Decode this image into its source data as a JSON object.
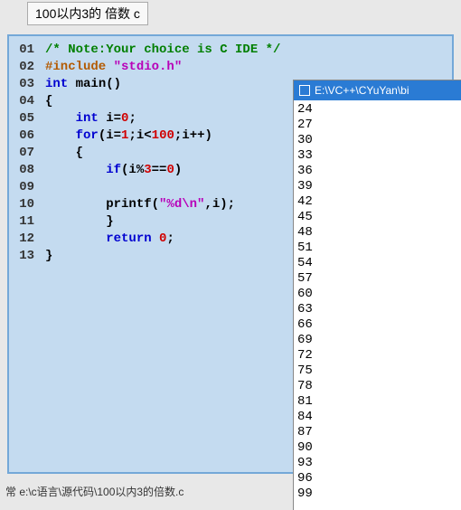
{
  "tab": {
    "title": "100以内3的\n倍数  c"
  },
  "code": {
    "lines": [
      "01",
      "02",
      "03",
      "04",
      "05",
      "06",
      "07",
      "08",
      "09",
      "10",
      "11",
      "12",
      "13"
    ],
    "l1_comment": "/* Note:Your choice is C IDE */",
    "l2_include": "#include ",
    "l2_header": "\"stdio.h\"",
    "l3_int": "int",
    "l3_main": " main()",
    "l4_brace": "{",
    "l5_int": "int",
    "l5_decl": " i=",
    "l5_zero": "0",
    "l5_semi": ";",
    "l6_for": "for",
    "l6_open": "(i=",
    "l6_one": "1",
    "l6_mid": ";i<",
    "l6_hundred": "100",
    "l6_end": ";i++)",
    "l7_brace": "{",
    "l8_if": "if",
    "l8_open": "(i%",
    "l8_three": "3",
    "l8_eq": "==",
    "l8_zero": "0",
    "l8_close": ")",
    "l10_printf": "printf(",
    "l10_fmt": "\"%d\\n\"",
    "l10_end": ",i);",
    "l11_brace": "}",
    "l12_return": "return",
    "l12_sp": " ",
    "l12_zero": "0",
    "l12_semi": ";",
    "l13_brace": "}"
  },
  "status": {
    "text": "常 e:\\c语言\\源代码\\100以内3的倍数.c"
  },
  "console": {
    "title": "E:\\VC++\\CYuYan\\bi",
    "output": [
      "24",
      "27",
      "30",
      "33",
      "36",
      "39",
      "42",
      "45",
      "48",
      "51",
      "54",
      "57",
      "60",
      "63",
      "66",
      "69",
      "72",
      "75",
      "78",
      "81",
      "84",
      "87",
      "90",
      "93",
      "96",
      "99"
    ]
  },
  "chart_data": {
    "type": "table",
    "title": "Program output: multiples of 3 under 100 (visible portion)",
    "values": [
      24,
      27,
      30,
      33,
      36,
      39,
      42,
      45,
      48,
      51,
      54,
      57,
      60,
      63,
      66,
      69,
      72,
      75,
      78,
      81,
      84,
      87,
      90,
      93,
      96,
      99
    ]
  }
}
